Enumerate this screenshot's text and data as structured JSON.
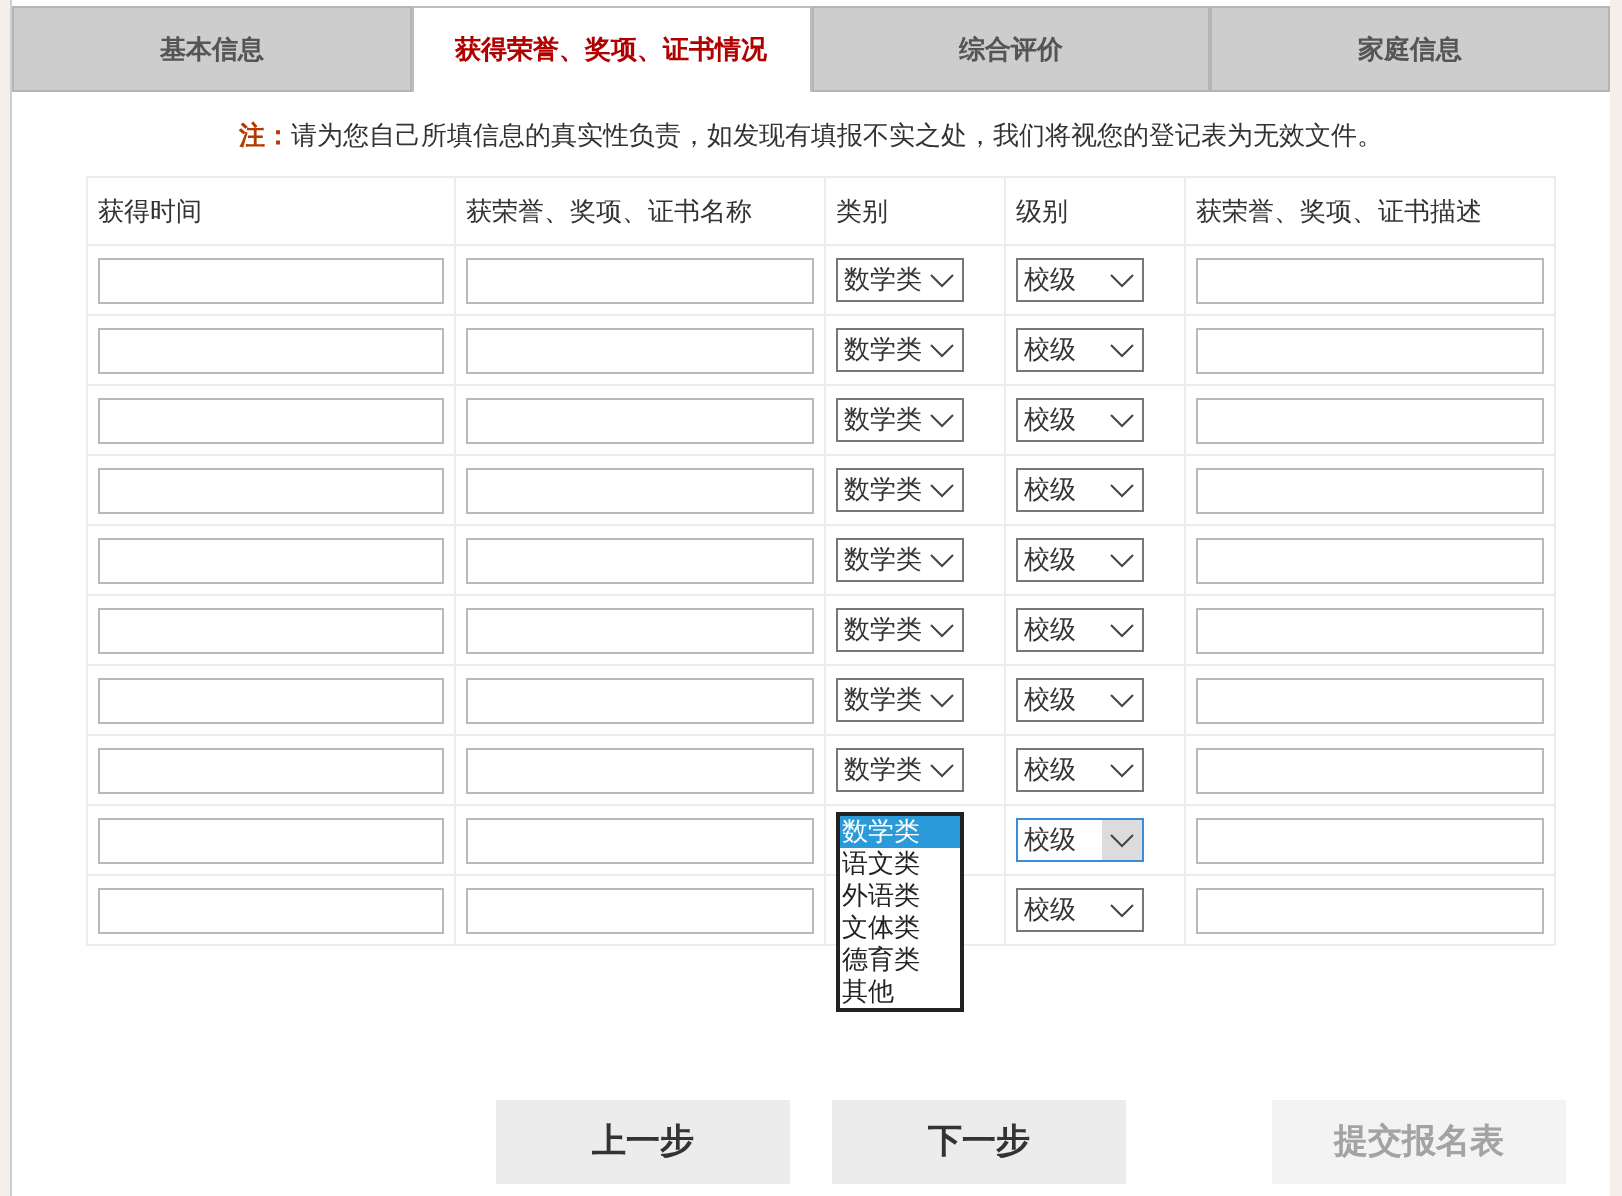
{
  "tabs": [
    {
      "label": "基本信息",
      "selected": false
    },
    {
      "label": "获得荣誉、奖项、证书情况",
      "selected": true
    },
    {
      "label": "综合评价",
      "selected": false
    },
    {
      "label": "家庭信息",
      "selected": false
    }
  ],
  "notice": {
    "label": "注：",
    "text": "请为您自己所填信息的真实性负责，如发现有填报不实之处，我们将视您的登记表为无效文件。"
  },
  "table": {
    "columns": [
      "获得时间",
      "获荣誉、奖项、证书名称",
      "类别",
      "级别",
      "获荣誉、奖项、证书描述"
    ],
    "rows": [
      {
        "category": {
          "value": "数学类"
        },
        "level": {
          "value": "校级",
          "focused": false
        }
      },
      {
        "category": {
          "value": "数学类"
        },
        "level": {
          "value": "校级",
          "focused": false
        }
      },
      {
        "category": {
          "value": "数学类"
        },
        "level": {
          "value": "校级",
          "focused": false
        }
      },
      {
        "category": {
          "value": "数学类"
        },
        "level": {
          "value": "校级",
          "focused": false
        }
      },
      {
        "category": {
          "value": "数学类"
        },
        "level": {
          "value": "校级",
          "focused": false
        }
      },
      {
        "category": {
          "value": "数学类"
        },
        "level": {
          "value": "校级",
          "focused": false
        }
      },
      {
        "category": {
          "value": "数学类"
        },
        "level": {
          "value": "校级",
          "focused": false
        }
      },
      {
        "category": {
          "value": "数学类"
        },
        "level": {
          "value": "校级",
          "focused": false
        }
      },
      {
        "category": {
          "open": true,
          "options": [
            {
              "label": "数学类",
              "selected": true
            },
            {
              "label": "语文类",
              "selected": false
            },
            {
              "label": "外语类",
              "selected": false
            },
            {
              "label": "文体类",
              "selected": false
            },
            {
              "label": "德育类",
              "selected": false
            },
            {
              "label": "其他",
              "selected": false
            }
          ]
        },
        "level": {
          "value": "校级",
          "focused": true
        }
      },
      {
        "level": {
          "value": "校级",
          "focused": false
        }
      }
    ]
  },
  "buttons": [
    {
      "label": "上一步",
      "disabled": false
    },
    {
      "label": "下一步",
      "disabled": false
    },
    {
      "label": "提交报名表",
      "disabled": true
    }
  ]
}
